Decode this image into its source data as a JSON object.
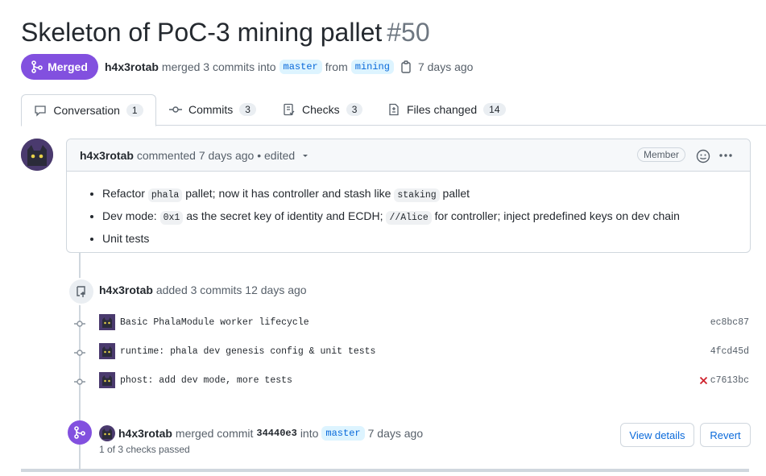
{
  "pr": {
    "title": "Skeleton of PoC-3 mining pallet",
    "number": "#50",
    "status": "Merged",
    "author": "h4x3rotab",
    "merge_summary": "merged 3 commits into",
    "base_branch": "master",
    "from_word": "from",
    "head_branch": "mining",
    "time": "7 days ago"
  },
  "tabs": [
    {
      "label": "Conversation",
      "count": "1"
    },
    {
      "label": "Commits",
      "count": "3"
    },
    {
      "label": "Checks",
      "count": "3"
    },
    {
      "label": "Files changed",
      "count": "14"
    }
  ],
  "comment": {
    "author": "h4x3rotab",
    "meta": "commented 7 days ago • edited",
    "role": "Member",
    "items": [
      {
        "a": "Refactor ",
        "c1": "phala",
        "b": " pallet; now it has controller and stash like ",
        "c2": "staking",
        "d": " pallet"
      },
      {
        "a": "Dev mode: ",
        "c1": "0x1",
        "b": " as the secret key of identity and ECDH; ",
        "c2": "//Alice",
        "d": " for controller; inject predefined keys on dev chain"
      },
      {
        "a": "Unit tests",
        "c1": "",
        "b": "",
        "c2": "",
        "d": ""
      }
    ]
  },
  "commits_event": {
    "author": "h4x3rotab",
    "text": "added 3 commits 12 days ago"
  },
  "commits": [
    {
      "message": "Basic PhalaModule worker lifecycle",
      "sha": "ec8bc87",
      "failed": false
    },
    {
      "message": "runtime: phala dev genesis config & unit tests",
      "sha": "4fcd45d",
      "failed": false
    },
    {
      "message": "phost: add dev mode, more tests",
      "sha": "c7613bc",
      "failed": true
    }
  ],
  "merge_event": {
    "author": "h4x3rotab",
    "text": "merged commit",
    "commit": "34440e3",
    "into": "into",
    "branch": "master",
    "time": "7 days ago",
    "checks": "1 of 3 checks passed",
    "view_details": "View details",
    "revert": "Revert"
  },
  "colors": {
    "accent": "#8250df",
    "link": "#0969da",
    "fail": "#cf222e"
  }
}
